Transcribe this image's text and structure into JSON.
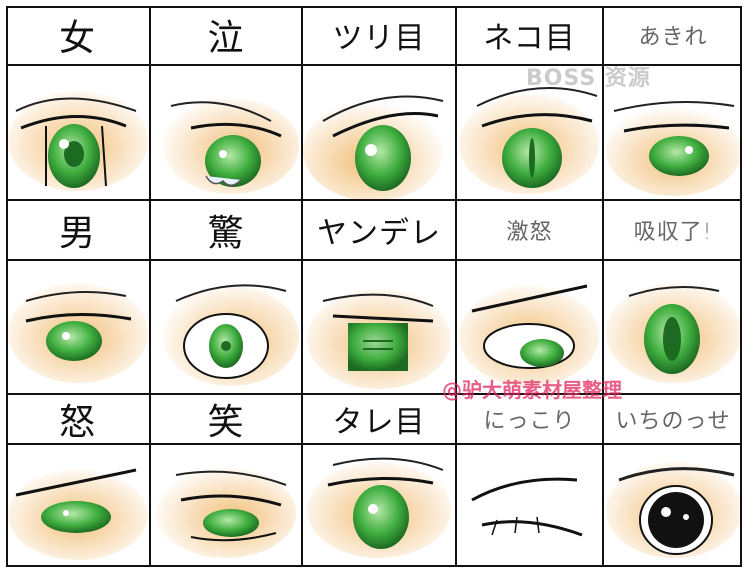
{
  "labels": {
    "onna": "女",
    "naki": "泣",
    "tsurime": "ツリ目",
    "nekome": "ネコ目",
    "akiraki": "あきれ",
    "otoko": "男",
    "odoroki": "驚",
    "yandere": "ヤンデレ",
    "gekido": "激怒",
    "kyuushuu": "吸収了!",
    "ikari": "怒",
    "warai": "笑",
    "tareme": "タレ目",
    "nikkori": "にっこり",
    "ichinose": "いちのっせ"
  },
  "watermarks": {
    "boss": "BOSS 资源",
    "credit": "@驴大萌素材屋整理"
  },
  "colors": {
    "iris": "#3fae3f",
    "iris_dark": "#1d6b22",
    "shade": "#f2c07a",
    "line": "#111111"
  }
}
